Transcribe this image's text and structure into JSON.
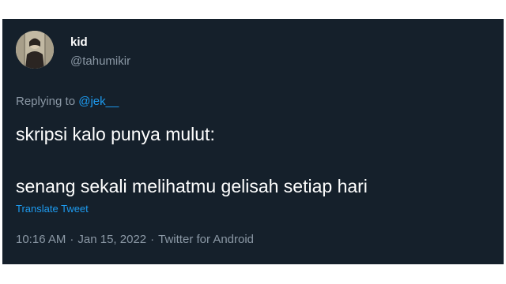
{
  "tweet": {
    "author": {
      "display_name": "kid",
      "handle": "@tahumikir",
      "avatar_icon": "user-avatar-photo"
    },
    "reply": {
      "prefix": "Replying to ",
      "mention": "@jek__"
    },
    "text_line1": "skripsi kalo punya mulut:",
    "text_line2": "senang sekali melihatmu gelisah setiap hari",
    "translate_label": "Translate Tweet",
    "meta": {
      "time": "10:16 AM",
      "separator": "·",
      "date": "Jan 15, 2022",
      "source": "Twitter for Android"
    }
  },
  "colors": {
    "background": "#15202b",
    "primary_text": "#ffffff",
    "secondary_text": "#8b98a5",
    "accent": "#1d9bf0"
  }
}
